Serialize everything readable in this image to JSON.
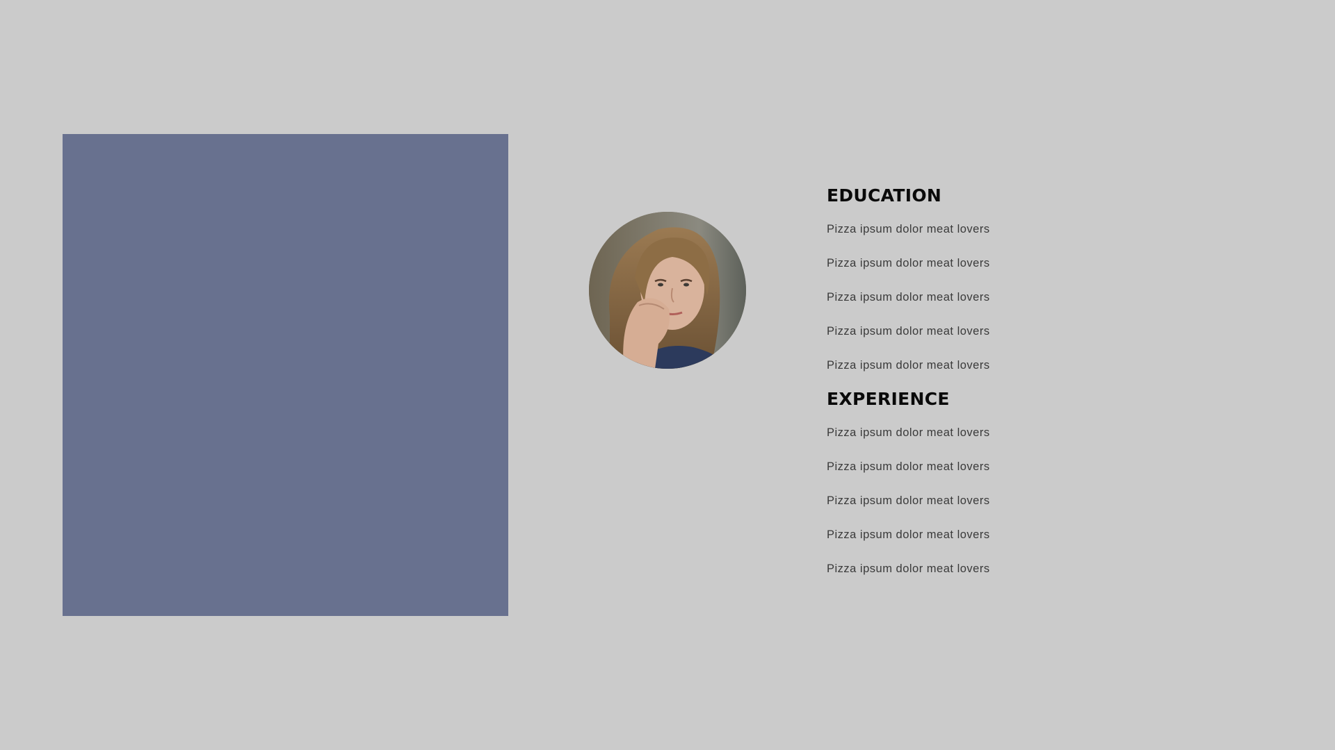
{
  "colors": {
    "background": "#cbcbcb",
    "block": "#68718f",
    "heading": "#0a0a0a",
    "text": "#3a3a3a"
  },
  "education": {
    "heading": "EDUCATION",
    "items": [
      "Pizza ipsum dolor meat lovers",
      "Pizza ipsum dolor meat lovers",
      "Pizza ipsum dolor meat lovers",
      "Pizza ipsum dolor meat lovers",
      "Pizza ipsum dolor meat lovers"
    ]
  },
  "experience": {
    "heading": "EXPERIENCE",
    "items": [
      "Pizza ipsum dolor meat lovers",
      "Pizza ipsum dolor meat lovers",
      "Pizza ipsum dolor meat lovers",
      "Pizza ipsum dolor meat lovers",
      "Pizza ipsum dolor meat lovers"
    ]
  }
}
